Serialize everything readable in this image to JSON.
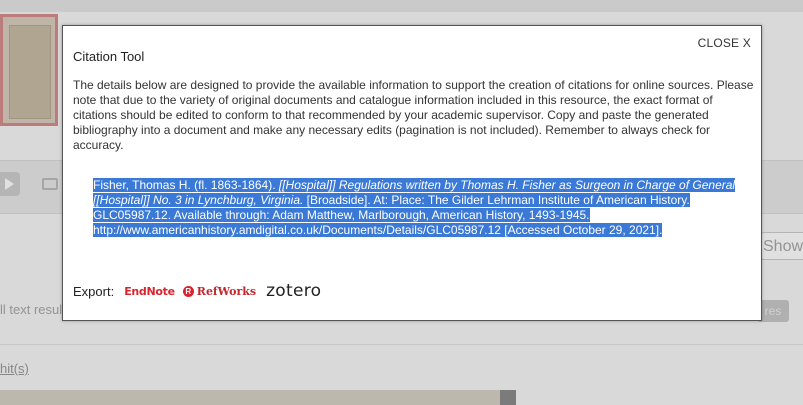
{
  "background": {
    "all_text_results": "ll text resul",
    "show_button": "Show",
    "results_badge": "res",
    "hits_link": "hit(s)"
  },
  "modal": {
    "close_label": "CLOSE X",
    "title": "Citation Tool",
    "description": "The details below are designed to provide the available information to support the creation of citations for online sources. Please note that due to the variety of original documents and catalogue information included in this resource, the exact format of citations should be edited to conform to that recommended by your academic supervisor. Copy and paste the generated bibliography into a document and make any necessary edits (pagination is not included). Remember to always check for accuracy.",
    "citation": {
      "part1": "Fisher, Thomas H. (fl. 1863-1864). ",
      "title_italic": "[[Hospital]] Regulations written by Thomas H. Fisher as Surgeon in Charge of General [[Hospital]] No. 3 in Lynchburg, Virginia.",
      "part2": " [Broadside]. At: Place: The Gilder Lehrman Institute of American History. GLC05987.12. Available through: Adam Matthew, Marlborough, American History, 1493-1945. http://www.americanhistory.amdigital.co.uk/Documents/Details/GLC05987.12 [Accessed October 29, 2021]."
    },
    "export": {
      "label": "Export:",
      "endnote": "EndNote",
      "refworks": "RefWorks",
      "refworks_icon": "R",
      "zotero": "zotero"
    }
  },
  "colors": {
    "selection": "#3a79d6",
    "brand_red": "#d9232d"
  }
}
